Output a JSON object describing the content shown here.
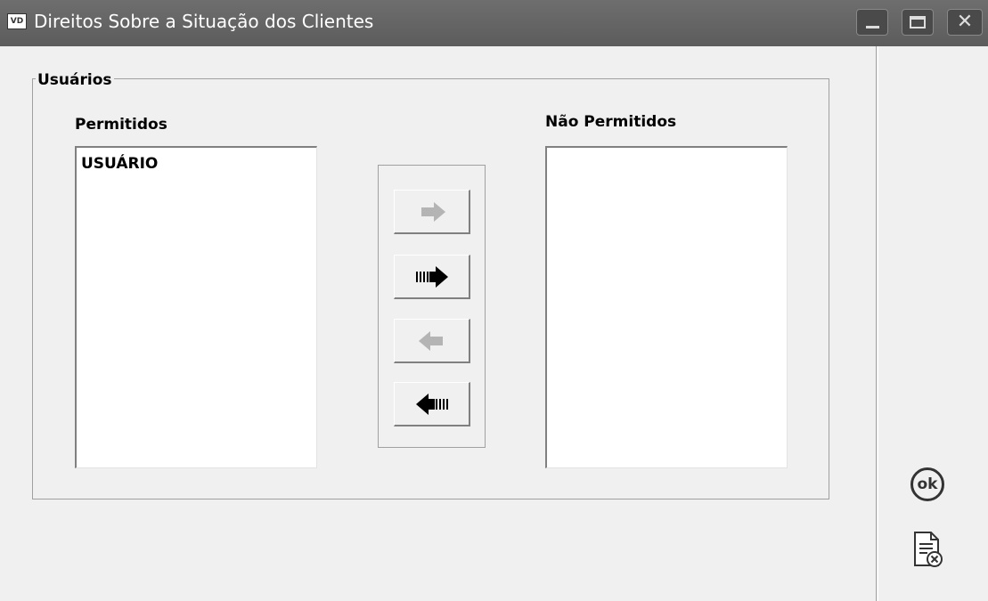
{
  "window": {
    "app_icon_text": "VD",
    "title": "Direitos Sobre a Situação dos Clientes",
    "controls": [
      "minimize",
      "maximize",
      "close"
    ]
  },
  "group": {
    "legend": "Usuários"
  },
  "lists": {
    "permitidos": {
      "label": "Permitidos",
      "items": [
        "USUÁRIO"
      ]
    },
    "nao_permitidos": {
      "label": "Não Permitidos",
      "items": []
    }
  },
  "transfer_buttons": [
    {
      "name": "move-selected-right",
      "icon": "arrow-right-icon",
      "enabled": false
    },
    {
      "name": "move-all-right",
      "icon": "arrow-right-all-icon",
      "enabled": true
    },
    {
      "name": "move-selected-left",
      "icon": "arrow-left-icon",
      "enabled": false
    },
    {
      "name": "move-all-left",
      "icon": "arrow-left-all-icon",
      "enabled": true
    }
  ],
  "side_actions": {
    "ok_label": "ok",
    "cancel_icon": "document-cancel-icon"
  },
  "colors": {
    "titlebar": "#606060",
    "window_bg": "#f0f0f0",
    "disabled_arrow": "#b4b4b4",
    "enabled_arrow": "#000000"
  }
}
